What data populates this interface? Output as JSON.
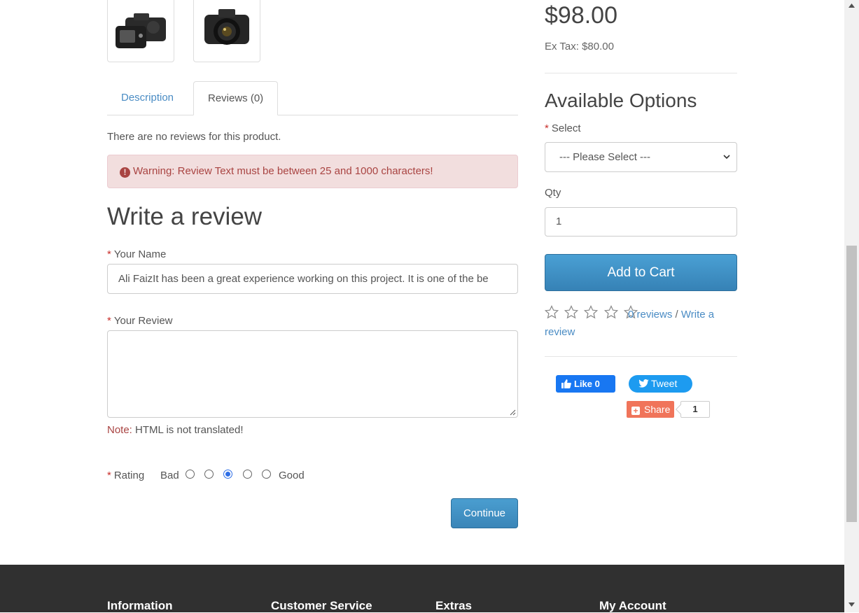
{
  "product": {
    "thumbnails": [
      {
        "name": "camera-back-thumbnail"
      },
      {
        "name": "camera-front-thumbnail"
      }
    ],
    "price": "$98.00",
    "ex_tax": "Ex Tax: $80.00"
  },
  "tabs": [
    {
      "label": "Description",
      "active": false
    },
    {
      "label": "Reviews (0)",
      "active": true
    }
  ],
  "reviews": {
    "empty_text": "There are no reviews for this product.",
    "warning": "Warning: Review Text must be between 25 and 1000 characters!",
    "heading": "Write a review",
    "name_label": "Your Name",
    "name_value": "Ali FaizIt has been a great experience working on this project. It is one of the be",
    "review_label": "Your Review",
    "review_value": "",
    "note_prefix": "Note:",
    "note_text": "HTML is not translated!",
    "rating_label": "Rating",
    "rating_bad": "Bad",
    "rating_good": "Good",
    "rating_selected": 3,
    "continue_label": "Continue"
  },
  "options": {
    "heading": "Available Options",
    "select_label": "Select",
    "select_value": "--- Please Select ---",
    "qty_label": "Qty",
    "qty_value": "1",
    "add_to_cart": "Add to Cart"
  },
  "rating_summary": {
    "stars": 0,
    "reviews_link": "0 reviews",
    "separator": "/",
    "write_link": "Write a review"
  },
  "social": {
    "fb_like": "Like",
    "fb_count": "0",
    "tweet": "Tweet",
    "share": "Share",
    "share_count": "1"
  },
  "footer": {
    "headings": [
      "Information",
      "Customer Service",
      "Extras",
      "My Account"
    ]
  },
  "colors": {
    "link": "#4a8cc4",
    "alert_bg": "#f2dede",
    "alert_text": "#a94442",
    "button": "#3a85b8",
    "footer_bg": "#303030"
  }
}
